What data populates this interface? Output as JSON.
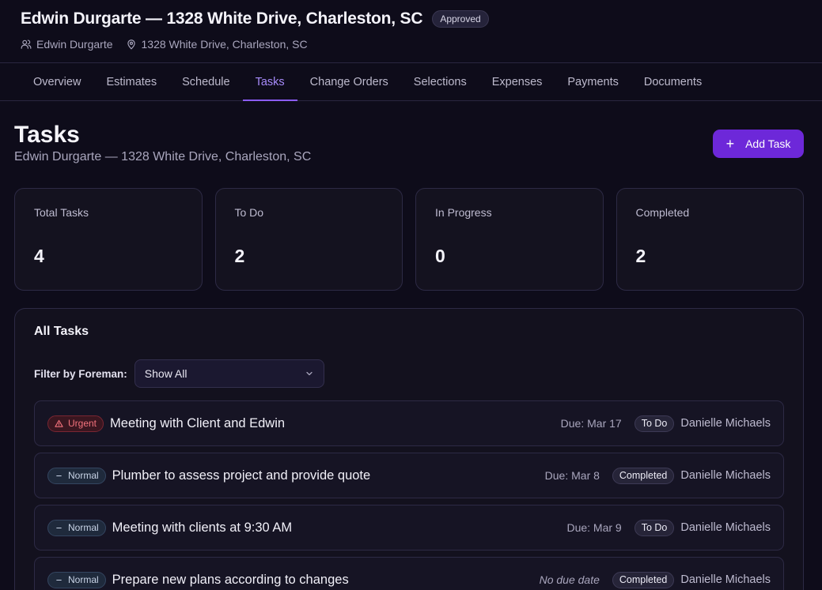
{
  "header": {
    "title": "Edwin Durgarte — 1328 White Drive, Charleston, SC",
    "status_badge": "Approved",
    "client": "Edwin Durgarte",
    "address": "1328 White Drive, Charleston, SC"
  },
  "tabs": [
    {
      "label": "Overview"
    },
    {
      "label": "Estimates"
    },
    {
      "label": "Schedule"
    },
    {
      "label": "Tasks",
      "active": true
    },
    {
      "label": "Change Orders"
    },
    {
      "label": "Selections"
    },
    {
      "label": "Expenses"
    },
    {
      "label": "Payments"
    },
    {
      "label": "Documents"
    }
  ],
  "page": {
    "title": "Tasks",
    "subtitle": "Edwin Durgarte — 1328 White Drive, Charleston, SC",
    "add_button": "Add Task"
  },
  "stats": [
    {
      "label": "Total Tasks",
      "value": "4"
    },
    {
      "label": "To Do",
      "value": "2"
    },
    {
      "label": "In Progress",
      "value": "0"
    },
    {
      "label": "Completed",
      "value": "2"
    }
  ],
  "tasks_panel": {
    "title": "All Tasks",
    "filter_label": "Filter by Foreman:",
    "filter_value": "Show All",
    "tasks": [
      {
        "priority": "Urgent",
        "name": "Meeting with Client and Edwin",
        "due": "Due: Mar 17",
        "status": "To Do",
        "assignee": "Danielle Michaels"
      },
      {
        "priority": "Normal",
        "name": "Plumber to assess project and provide quote",
        "due": "Due: Mar 8",
        "status": "Completed",
        "assignee": "Danielle Michaels"
      },
      {
        "priority": "Normal",
        "name": "Meeting with clients at 9:30 AM",
        "due": "Due: Mar 9",
        "status": "To Do",
        "assignee": "Danielle Michaels"
      },
      {
        "priority": "Normal",
        "name": "Prepare new plans according to changes",
        "due": "No due date",
        "status": "Completed",
        "assignee": "Danielle Michaels"
      }
    ]
  },
  "colors": {
    "background": "#0e0c1a",
    "accent": "#8b5cf6",
    "button": "#6d28d9",
    "urgent": "#f2727c"
  },
  "icons": {
    "client": "users-icon",
    "address": "map-pin-icon",
    "add": "plus-icon",
    "dropdown": "chevron-down-icon",
    "urgent": "alert-triangle-icon",
    "normal": "minus-icon"
  }
}
